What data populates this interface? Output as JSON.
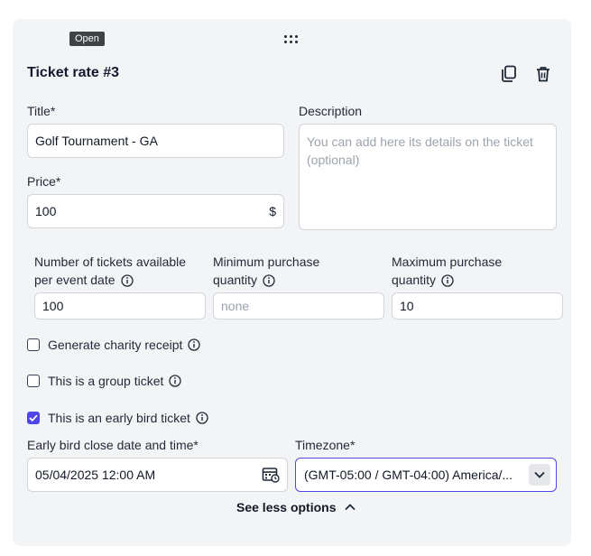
{
  "tooltip": "Open",
  "card": {
    "title": "Ticket rate #3",
    "icons": {
      "copy": "copy-icon",
      "delete": "trash-icon"
    }
  },
  "fields": {
    "title_label": "Title*",
    "title_value": "Golf Tournament - GA",
    "description_label": "Description",
    "description_placeholder": "You can add here its details on the ticket (optional)",
    "price_label": "Price*",
    "price_value": "100",
    "price_currency": "$",
    "tickets_available_label_1": "Number of tickets available",
    "tickets_available_label_2": "per event date",
    "tickets_available_value": "100",
    "min_purchase_label_1": "Minimum purchase",
    "min_purchase_label_2": "quantity",
    "min_purchase_placeholder": "none",
    "max_purchase_label_1": "Maximum purchase",
    "max_purchase_label_2": "quantity",
    "max_purchase_value": "10"
  },
  "checkboxes": {
    "charity": {
      "label": "Generate charity receipt",
      "checked": false
    },
    "group": {
      "label": "This is a group ticket",
      "checked": false
    },
    "early_bird": {
      "label": "This is an early bird ticket",
      "checked": true
    }
  },
  "early_bird": {
    "close_label": "Early bird close date and time*",
    "close_value": "05/04/2025 12:00 AM",
    "timezone_label": "Timezone*",
    "timezone_value": "(GMT-05:00 / GMT-04:00) America/..."
  },
  "footer": {
    "see_less": "See less options"
  },
  "colors": {
    "accent": "#4f46e5",
    "card_bg": "#f3f4f6",
    "tooltip_bg": "#3f4246"
  }
}
